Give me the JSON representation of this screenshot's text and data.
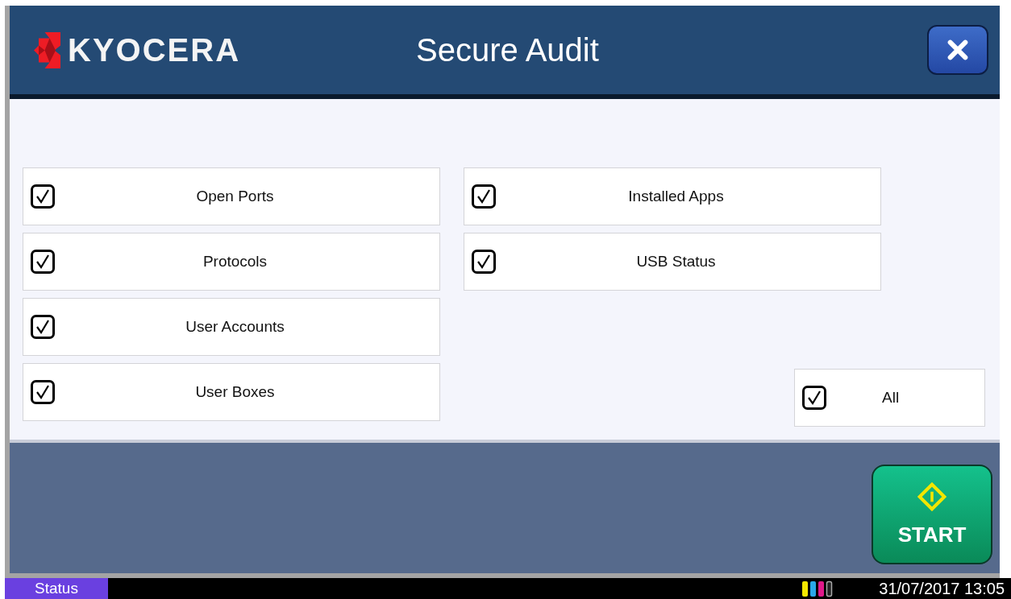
{
  "header": {
    "logo": "KYOCERA",
    "title": "Secure Audit"
  },
  "columns": [
    {
      "options": [
        {
          "label": "Open Ports",
          "checked": true
        },
        {
          "label": "Protocols",
          "checked": true
        },
        {
          "label": "User Accounts",
          "checked": true
        },
        {
          "label": "User Boxes",
          "checked": true
        }
      ]
    },
    {
      "options": [
        {
          "label": "Installed Apps",
          "checked": true
        },
        {
          "label": "USB Status",
          "checked": true
        }
      ]
    }
  ],
  "all_option": {
    "label": "All",
    "checked": true
  },
  "start_button": {
    "label": "START"
  },
  "status_bar": {
    "status_button": "Status",
    "datetime": "31/07/2017 13:05"
  }
}
